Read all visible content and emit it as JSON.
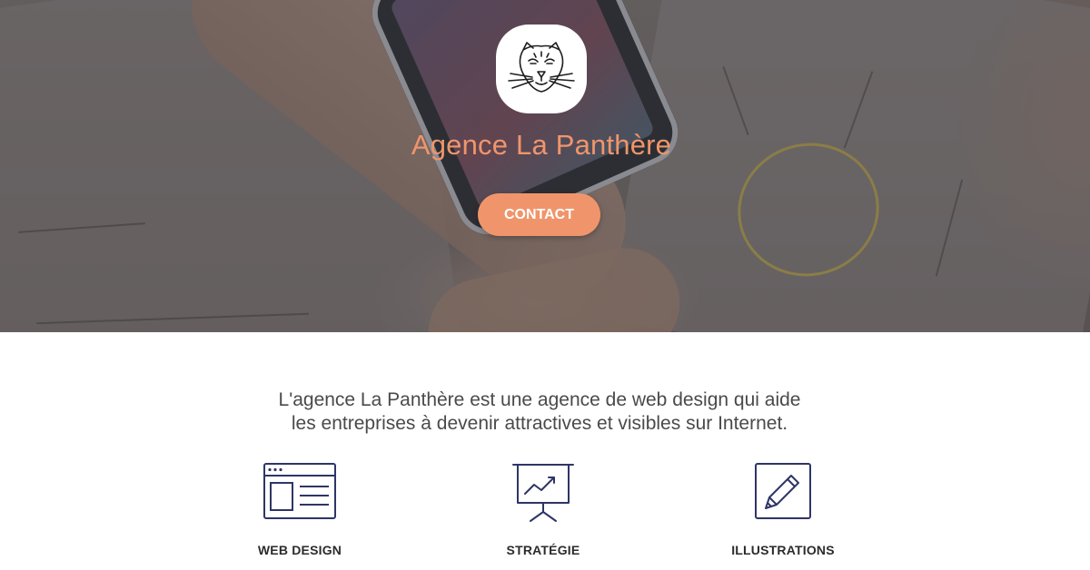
{
  "hero": {
    "brand_name": "Agence La Panthère",
    "contact_label": "CONTACT",
    "logo_icon": "panther-head-icon"
  },
  "intro": {
    "line1": "L'agence La Panthère est une agence de web design qui aide",
    "line2": "les entreprises à devenir attractives et visibles sur Internet."
  },
  "services": [
    {
      "label": "WEB DESIGN",
      "icon": "browser-window-icon"
    },
    {
      "label": "STRATÉGIE",
      "icon": "presentation-chart-icon"
    },
    {
      "label": "ILLUSTRATIONS",
      "icon": "pencil-frame-icon"
    }
  ],
  "colors": {
    "accent": "#f0956b",
    "icon_stroke": "#2e3566",
    "text": "#4a4a4a"
  }
}
